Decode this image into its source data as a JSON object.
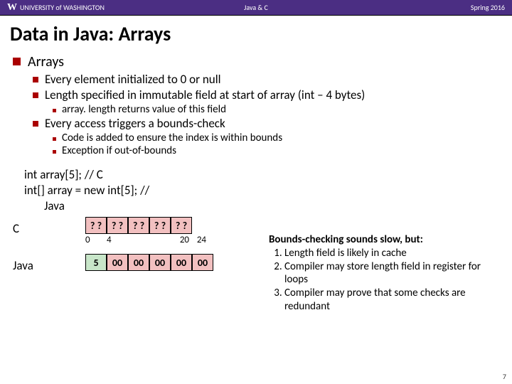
{
  "header": {
    "institution": "UNIVERSITY of WASHINGTON",
    "course": "Java & C",
    "term": "Spring 2016"
  },
  "title": "Data in Java: Arrays",
  "bullets": {
    "l1": "Arrays",
    "l2a": "Every element initialized to 0 or null",
    "l2b": "Length specified in immutable field at start of array (int – 4 bytes)",
    "l3a": "array. length returns value of this field",
    "l2c": "Every access triggers a bounds-check",
    "l3b": "Code is added to ensure the index is within bounds",
    "l3c": "Exception if out-of-bounds"
  },
  "code": {
    "line1": "int array[5];                    //  C",
    "line2": "int[] array = new int[5];                 //",
    "line2b": "Java"
  },
  "diagram": {
    "c_label": "C",
    "java_label": "Java",
    "c_cells": [
      "? ?",
      "? ?",
      "? ?",
      "? ?",
      "? ?"
    ],
    "c_ticks": [
      "0",
      "4",
      "",
      "",
      "",
      "20",
      "24"
    ],
    "java_length": "5",
    "java_cells": [
      "00",
      "00",
      "00",
      "00",
      "00"
    ]
  },
  "right": {
    "heading": "Bounds-checking sounds slow, but:",
    "items": [
      "Length field is likely in cache",
      "Compiler may store length field in register for loops",
      "Compiler may prove that some checks are redundant"
    ]
  },
  "page_num": "7"
}
